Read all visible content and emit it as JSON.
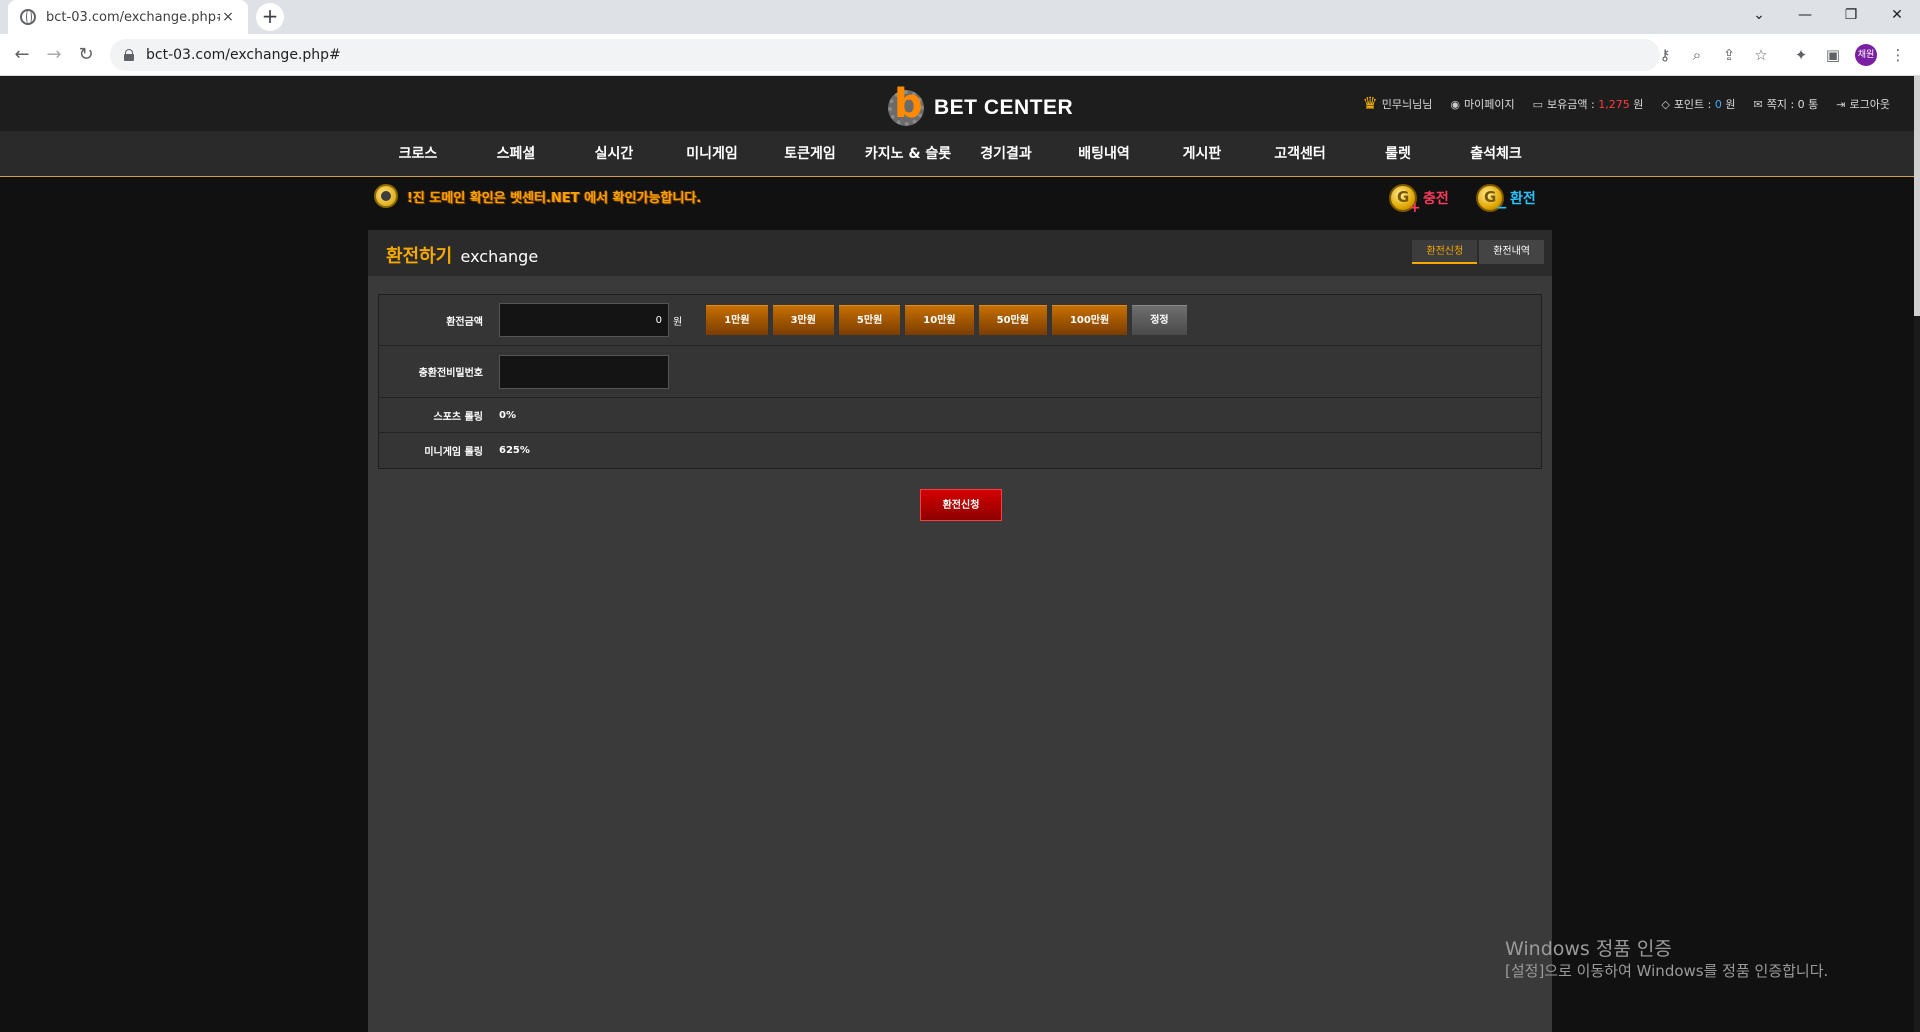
{
  "browser": {
    "tab_title": "bct-03.com/exchange.php#",
    "tab_close": "×",
    "new_tab": "+",
    "url": "bct-03.com/exchange.php#",
    "profile_initials": "채원",
    "window_controls": {
      "dropdown": "⌄",
      "minimize": "—",
      "restore": "❐",
      "close": "✕"
    }
  },
  "site": {
    "logo_text": "BET CENTER",
    "logo_letter": "b",
    "user": {
      "nickname": "민무늬님님",
      "mypage": "마이페이지",
      "balance_label": "보유금액 :",
      "balance_value": "1,275",
      "balance_unit": "원",
      "points_label": "포인트 :",
      "points_value": "0",
      "points_unit": "원",
      "messages_label": "쪽지 :",
      "messages_value": "0",
      "messages_unit": "통",
      "logout": "로그아웃"
    },
    "nav": [
      "크로스",
      "스페셜",
      "실시간",
      "미니게임",
      "토큰게임",
      "카지노 & 슬롯",
      "경기결과",
      "배팅내역",
      "게시판",
      "고객센터",
      "룰렛",
      "출석체크"
    ],
    "notice": "!진 도메인 확인은 벳센터.NET 에서 확인가능합니다.",
    "charge_label": "충전",
    "exchange_label": "환전"
  },
  "panel": {
    "title": "환전하기",
    "subtitle": "exchange",
    "tabs": [
      "환전신청",
      "환전내역"
    ],
    "rows": {
      "amount_label": "환전금액",
      "amount_value": "0",
      "won": "원",
      "amount_buttons": [
        "1만원",
        "3만원",
        "5만원",
        "10만원",
        "50만원",
        "100만원"
      ],
      "reset": "정정",
      "password_label": "충환전비밀번호",
      "sports_label": "스포츠 롤링",
      "sports_value": "0%",
      "mini_label": "미니게임 롤링",
      "mini_value": "625%"
    },
    "submit": "환전신청"
  },
  "watermark": {
    "title": "Windows 정품 인증",
    "sub": "[설정]으로 이동하여 Windows를 정품 인증합니다."
  }
}
